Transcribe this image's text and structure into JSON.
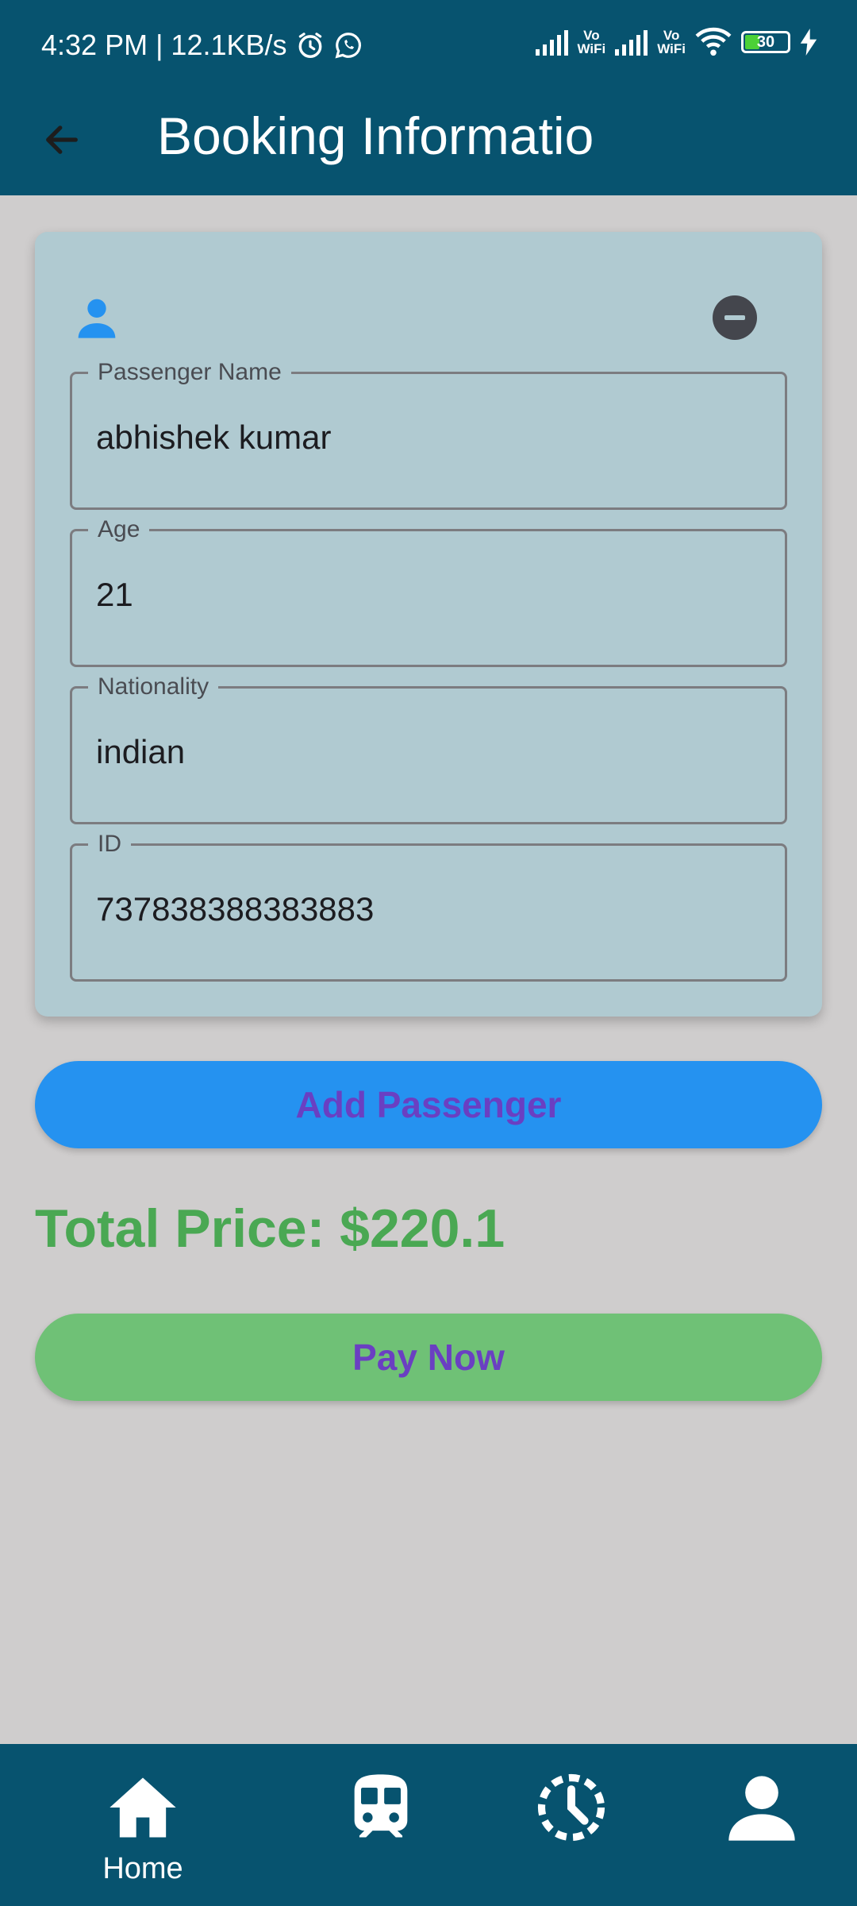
{
  "status_bar": {
    "time_speed": "4:32 PM | 12.1KB/s",
    "sim1_label_top": "Vo",
    "sim1_label_bottom": "WiFi",
    "sim2_label_top": "Vo",
    "sim2_label_bottom": "WiFi",
    "battery_level": "30"
  },
  "app_bar": {
    "title": "Booking Informatio"
  },
  "passenger": {
    "fields": [
      {
        "label": "Passenger Name",
        "value": "abhishek kumar"
      },
      {
        "label": "Age",
        "value": "21"
      },
      {
        "label": "Nationality",
        "value": "indian"
      },
      {
        "label": "ID",
        "value": "737838388383883"
      }
    ]
  },
  "actions": {
    "add_passenger": "Add Passenger",
    "total_price": "Total Price: $220.1",
    "pay_now": "Pay Now"
  },
  "bottom_nav": {
    "home_label": "Home",
    "icons": [
      "home-icon",
      "train-icon",
      "history-icon",
      "profile-icon"
    ]
  },
  "colors": {
    "app_bar": "#07536f",
    "card": "#b0cad1",
    "add_button": "#2592f0",
    "pay_button": "#6fc176",
    "button_text": "#6a3fc2",
    "total_price": "#4aa853",
    "background": "#cfcdcd"
  }
}
